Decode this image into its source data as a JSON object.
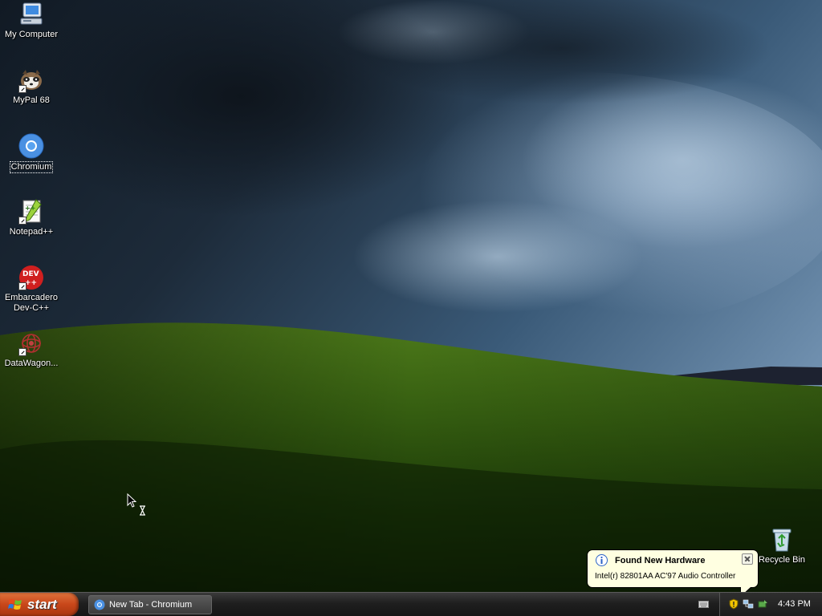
{
  "desktop": {
    "icons": [
      {
        "label": "My Computer",
        "icon": "my-computer-icon",
        "selected": false
      },
      {
        "label": "MyPal 68",
        "icon": "mypal-icon",
        "selected": false
      },
      {
        "label": "Chromium",
        "icon": "chromium-icon",
        "selected": true
      },
      {
        "label": "Notepad++",
        "icon": "notepad-plus-plus-icon",
        "selected": false
      },
      {
        "label": "Embarcadero Dev-C++",
        "icon": "dev-cpp-icon",
        "selected": false
      },
      {
        "label": "DataWagon...",
        "icon": "datawagon-icon",
        "selected": false
      }
    ],
    "recycle_bin": {
      "label": "Recycle Bin",
      "icon": "recycle-bin-icon"
    }
  },
  "balloon": {
    "title": "Found New Hardware",
    "message": "Intel(r) 82801AA AC'97 Audio Controller"
  },
  "taskbar": {
    "start_label": "start",
    "task_button": {
      "label": "New Tab - Chromium",
      "icon": "chromium-icon"
    },
    "clock": "4:43 PM"
  },
  "colors": {
    "taskbar": "#1f1f1f",
    "start_button": "#c8471a",
    "balloon_bg": "#ffffe1"
  }
}
